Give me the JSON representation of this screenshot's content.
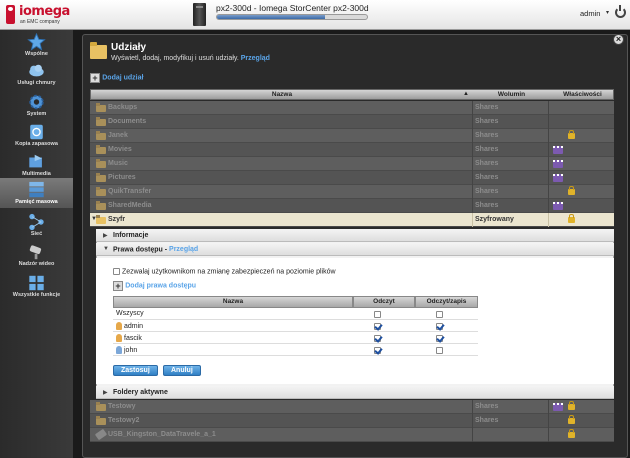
{
  "topbar": {
    "brand": "iomega",
    "brand_sub": "an EMC company",
    "device_title": "px2-300d - Iomega StorCenter px2-300d",
    "progress": 0.72,
    "user": "admin"
  },
  "sidebar": {
    "items": [
      {
        "label": "Wspólne",
        "icon": "star-icon"
      },
      {
        "label": "Usługi chmury",
        "icon": "cloud-icon"
      },
      {
        "label": "System",
        "icon": "gear-icon"
      },
      {
        "label": "Kopia zapasowa",
        "icon": "backup-icon"
      },
      {
        "label": "Multimedia",
        "icon": "multimedia-icon"
      },
      {
        "label": "Pamięć masowa",
        "icon": "storage-icon",
        "active": true
      },
      {
        "label": "Sieć",
        "icon": "network-icon"
      },
      {
        "label": "Nadzór wideo",
        "icon": "camera-icon"
      },
      {
        "label": "Wszystkie funkcje",
        "icon": "grid-icon"
      }
    ]
  },
  "header": {
    "title": "Udziały",
    "subtitle": "Wyświetl, dodaj, modyfikuj i usuń udziały.",
    "subtitle_link": "Przegląd",
    "add_share": "Dodaj udział"
  },
  "table": {
    "columns": [
      "Nazwa",
      "Wolumin",
      "Właściwości"
    ],
    "rows": [
      {
        "name": "Backups",
        "volume": "Shares",
        "lock": false,
        "media": false
      },
      {
        "name": "Documents",
        "volume": "Shares",
        "lock": false,
        "media": false
      },
      {
        "name": "Janek",
        "volume": "Shares",
        "lock": true,
        "media": false
      },
      {
        "name": "Movies",
        "volume": "Shares",
        "lock": false,
        "media": true
      },
      {
        "name": "Music",
        "volume": "Shares",
        "lock": false,
        "media": true
      },
      {
        "name": "Pictures",
        "volume": "Shares",
        "lock": false,
        "media": true
      },
      {
        "name": "QuikTransfer",
        "volume": "Shares",
        "lock": true,
        "media": false
      },
      {
        "name": "SharedMedia",
        "volume": "Shares",
        "lock": false,
        "media": true
      },
      {
        "name": "Szyfr",
        "volume": "Szyfrowany",
        "lock": true,
        "media": false,
        "open": true
      }
    ],
    "rows_after": [
      {
        "name": "Testowy",
        "volume": "Shares",
        "lock": true,
        "media": true
      },
      {
        "name": "Testowy2",
        "volume": "Shares",
        "lock": true,
        "media": false
      },
      {
        "name": "USB_Kingston_DataTravele_a_1",
        "volume": "",
        "lock": true,
        "media": false,
        "usb": true
      }
    ]
  },
  "expanded": {
    "info_title": "Informacje",
    "perm_title": "Prawa dostępu -",
    "perm_link": "Przegląd",
    "allow_label": "Zezwalaj użytkownikom na zmianę zabezpieczeń na poziomie plików",
    "add_perm": "Dodaj prawa dostępu",
    "perm_columns": [
      "Nazwa",
      "Odczyt",
      "Odczyt/zapis"
    ],
    "perm_rows": [
      {
        "name": "Wszyscy",
        "read": false,
        "write": false,
        "icon": "none"
      },
      {
        "name": "admin",
        "read": true,
        "write": true,
        "icon": "user"
      },
      {
        "name": "fascik",
        "read": true,
        "write": true,
        "icon": "user"
      },
      {
        "name": "john",
        "read": true,
        "write": false,
        "icon": "user-blue"
      }
    ],
    "apply": "Zastosuj",
    "cancel": "Anuluj",
    "active_folders": "Foldery aktywne"
  }
}
